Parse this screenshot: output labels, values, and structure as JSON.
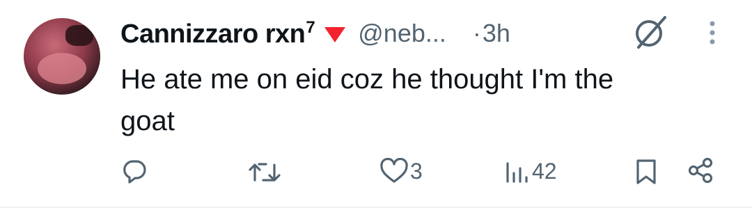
{
  "author": {
    "name": "Cannizzaro rxn",
    "name_sup": "7",
    "handle": "@neb...",
    "separator": "·",
    "time": "3h"
  },
  "tweet": {
    "text_line1": "He ate me on eid coz he thought I'm the",
    "text_line2": "goat"
  },
  "actions": {
    "reply_count": "",
    "retweet_count": "",
    "like_count": "3",
    "views_count": "42"
  },
  "icons": {
    "badge": "red-triangle-icon",
    "grok": "grok-slash-circle-icon",
    "more": "more-vertical-icon",
    "reply": "reply-icon",
    "retweet": "retweet-icon",
    "like": "heart-icon",
    "views": "views-bar-icon",
    "bookmark": "bookmark-icon",
    "share": "share-icon"
  },
  "colors": {
    "text": "#0f1419",
    "secondary": "#536471",
    "badge": "#f4212e"
  }
}
